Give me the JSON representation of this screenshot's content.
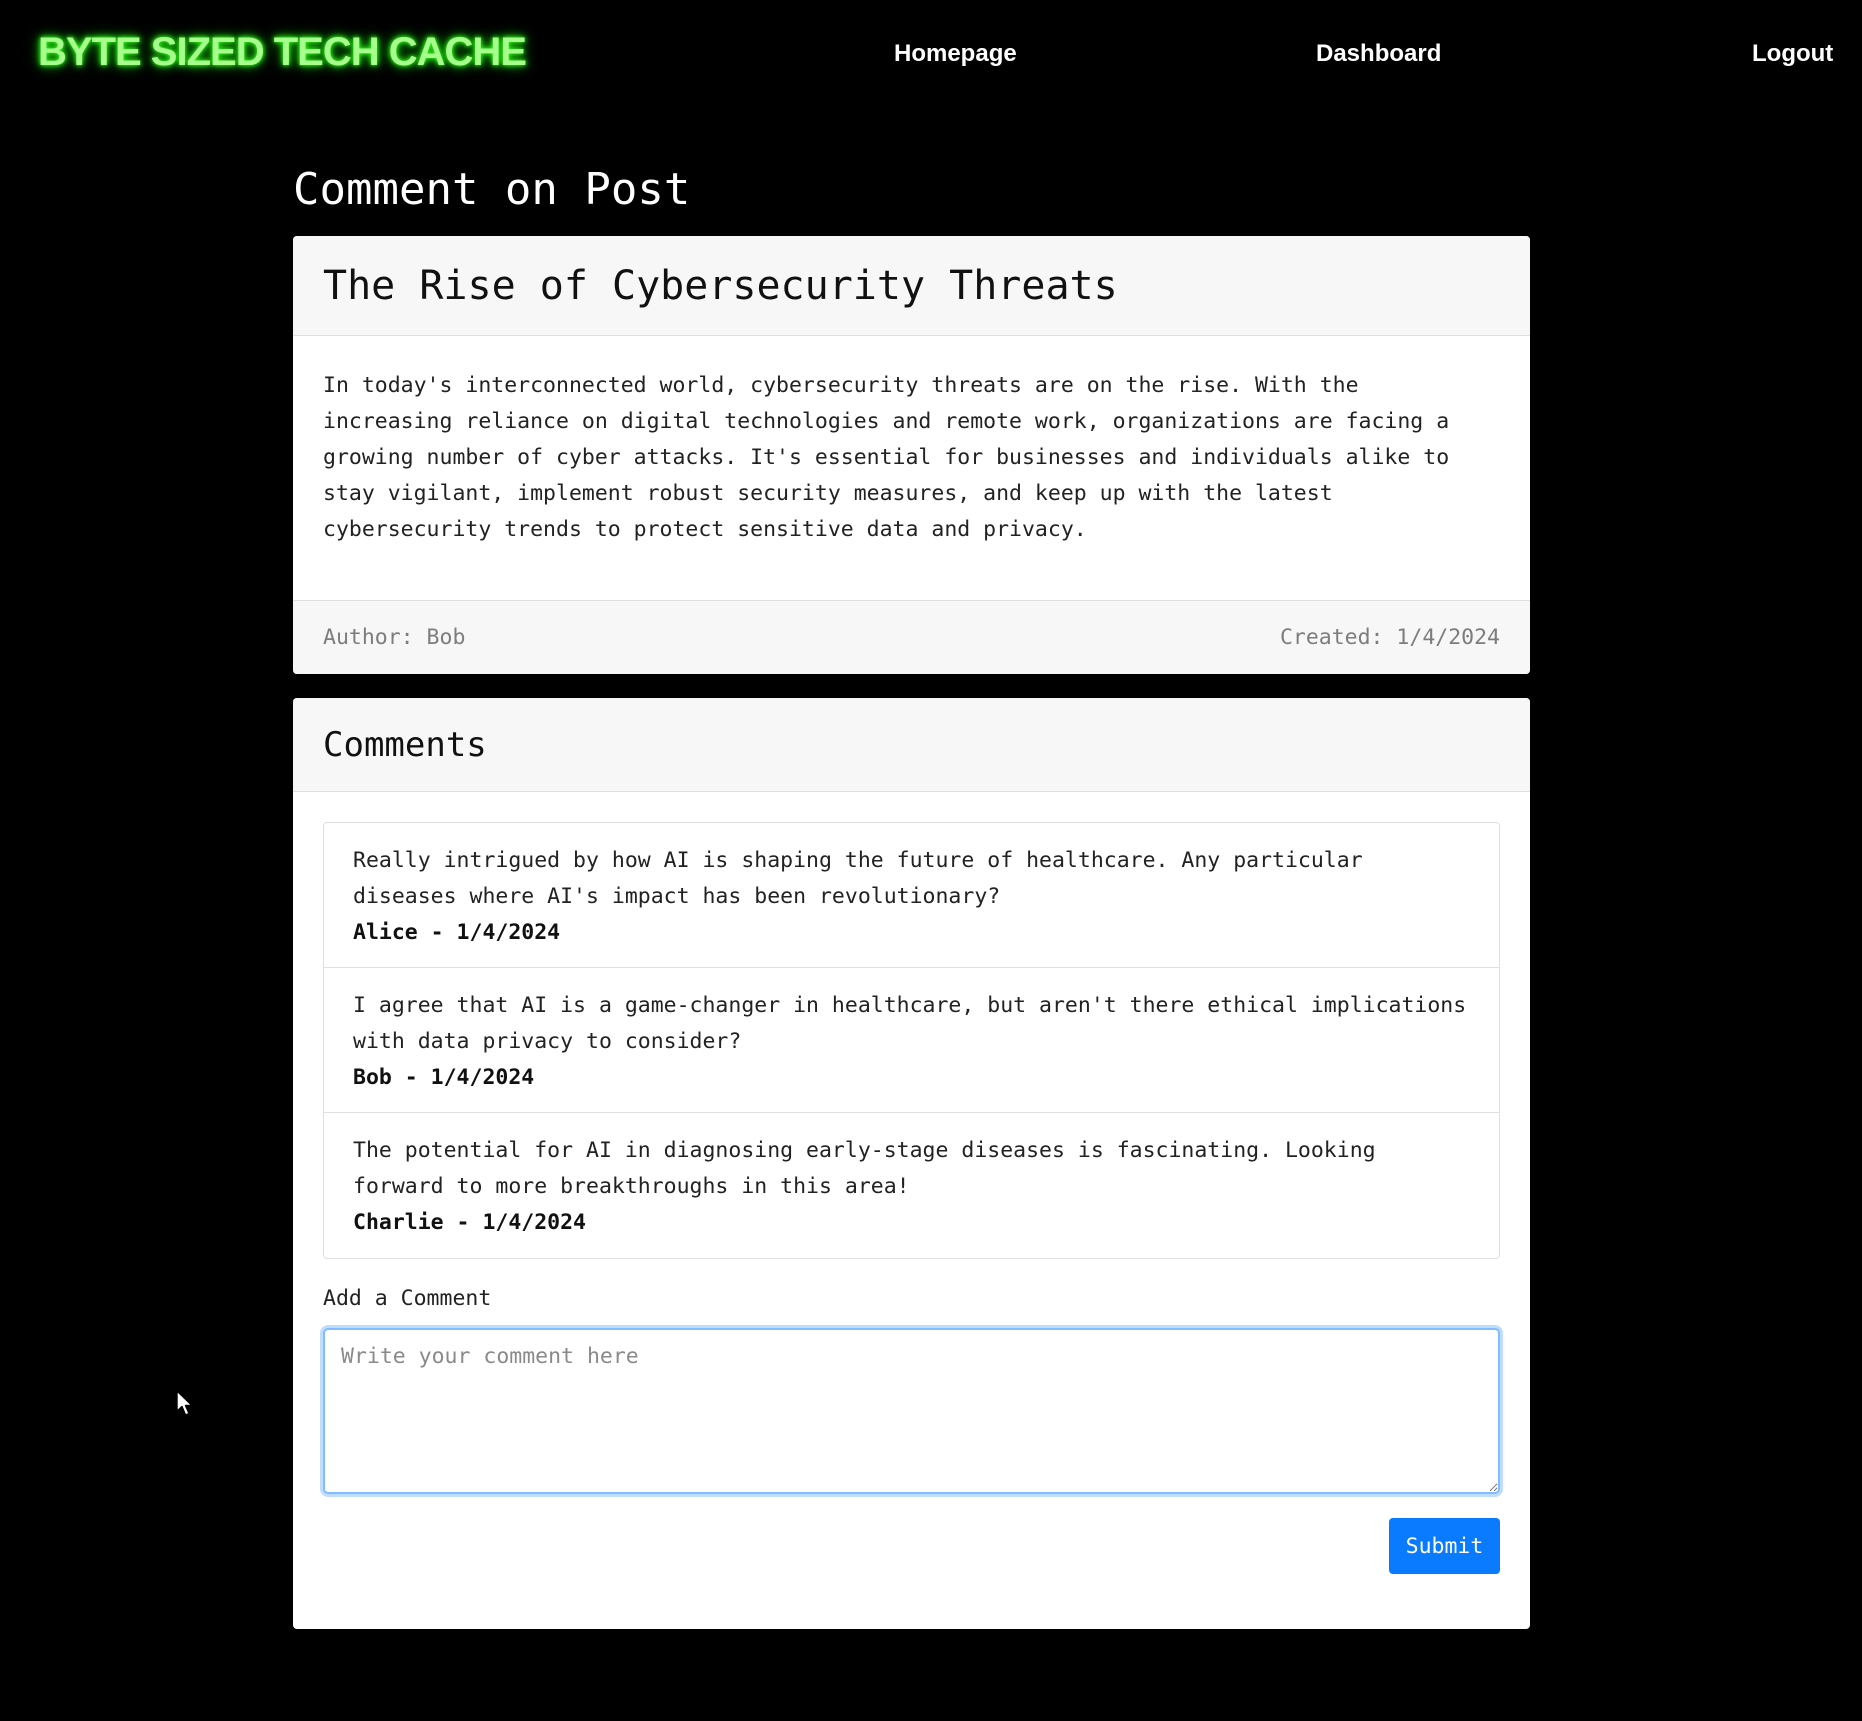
{
  "nav": {
    "brand": "BYTE SIZED TECH  CACHE",
    "links": {
      "home": "Homepage",
      "dashboard": "Dashboard",
      "logout": "Logout"
    }
  },
  "page": {
    "title": "Comment on Post"
  },
  "post": {
    "title": "The Rise of Cybersecurity Threats",
    "body": "In today's interconnected world, cybersecurity threats are on the rise. With the increasing reliance on digital technologies and remote work, organizations are facing a growing number of cyber attacks. It's essential for businesses and individuals alike to stay vigilant, implement robust security measures, and keep up with the latest cybersecurity trends to protect sensitive data and privacy.",
    "author": "Author: Bob",
    "created": "Created: 1/4/2024"
  },
  "comments": {
    "title": "Comments",
    "items": [
      {
        "text": "Really intrigued by how AI is shaping the future of healthcare. Any particular diseases where AI's impact has been revolutionary?",
        "meta": "Alice - 1/4/2024"
      },
      {
        "text": "I agree that AI is a game-changer in healthcare, but aren't there ethical implications with data privacy to consider?",
        "meta": "Bob - 1/4/2024"
      },
      {
        "text": "The potential for AI in diagnosing early-stage diseases is fascinating. Looking forward to more breakthroughs in this area!",
        "meta": "Charlie - 1/4/2024"
      }
    ]
  },
  "form": {
    "label": "Add a Comment",
    "placeholder": "Write your comment here",
    "value": "",
    "submit_label": "Submit"
  },
  "colors": {
    "background": "#000000",
    "brand_glow": "#38ff1e",
    "primary": "#0a7bff",
    "focus_border": "#80bdff"
  },
  "icons": {
    "cursor": "mouse-pointer-icon"
  }
}
